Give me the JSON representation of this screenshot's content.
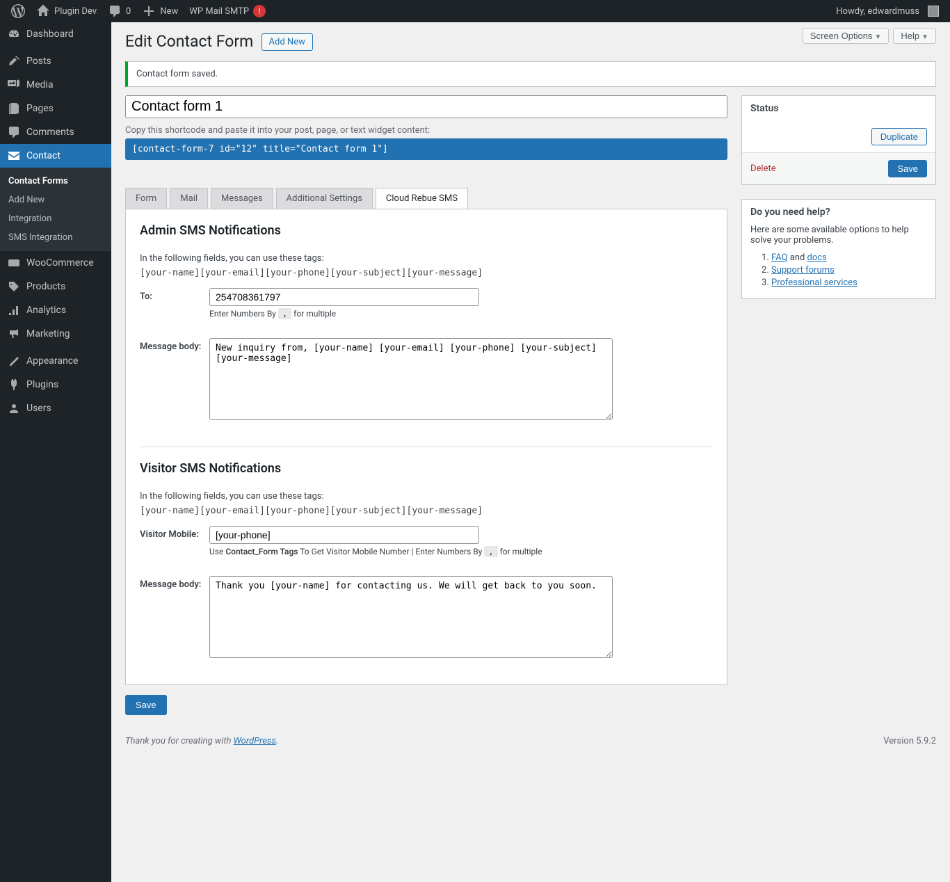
{
  "adminbar": {
    "site": "Plugin Dev",
    "comments": "0",
    "new": "New",
    "smtp": "WP Mail SMTP",
    "smtp_badge": "!",
    "howdy": "Howdy, edwardmuss"
  },
  "menu": {
    "dashboard": "Dashboard",
    "posts": "Posts",
    "media": "Media",
    "pages": "Pages",
    "comments": "Comments",
    "contact": "Contact",
    "woocommerce": "WooCommerce",
    "products": "Products",
    "analytics": "Analytics",
    "marketing": "Marketing",
    "appearance": "Appearance",
    "plugins": "Plugins",
    "users": "Users"
  },
  "submenu": {
    "contact_forms": "Contact Forms",
    "add_new": "Add New",
    "integration": "Integration",
    "sms": "SMS Integration"
  },
  "top_actions": {
    "screen": "Screen Options",
    "help": "Help"
  },
  "heading": "Edit Contact Form",
  "add_new": "Add New",
  "notice": "Contact form saved.",
  "title": "Contact form 1",
  "shortcode_label": "Copy this shortcode and paste it into your post, page, or text widget content:",
  "shortcode": "[contact-form-7 id=\"12\" title=\"Contact form 1\"]",
  "tabs": {
    "form": "Form",
    "mail": "Mail",
    "messages": "Messages",
    "additional": "Additional Settings",
    "cloud": "Cloud Rebue SMS"
  },
  "panel": {
    "admin_h": "Admin SMS Notifications",
    "taginfo": "In the following fields, you can use these tags:",
    "tagcode": "[your-name][your-email][your-phone][your-subject][your-message]",
    "to_lbl": "To:",
    "to_val": "254708361797",
    "to_hint_a": "Enter Numbers By ",
    "to_hint_b": " for multiple",
    "comma": ",",
    "body_lbl": "Message body:",
    "body_val": "New inquiry from, [your-name] [your-email] [your-phone] [your-subject] [your-message]",
    "visitor_h": "Visitor SMS Notifications",
    "vm_lbl": "Visitor Mobile:",
    "vm_val": "[your-phone]",
    "vm_hint_a": "Use ",
    "vm_hint_tag": "Contact_Form Tags",
    "vm_hint_b": " To Get Visitor Mobile Number | Enter Numbers By ",
    "vm_hint_c": " for multiple",
    "vbody_val": "Thank you [your-name] for contacting us. We will get back to you soon."
  },
  "side": {
    "status_h": "Status",
    "duplicate": "Duplicate",
    "delete": "Delete",
    "save": "Save",
    "help_h": "Do you need help?",
    "help_p": "Here are some available options to help solve your problems.",
    "faq": "FAQ",
    "and": " and ",
    "docs": "docs",
    "forums": "Support forums",
    "pro": "Professional services"
  },
  "save_btn": "Save",
  "footer": {
    "thank": "Thank you for creating with ",
    "wp": "WordPress",
    "dot": ".",
    "ver": "Version 5.9.2"
  }
}
